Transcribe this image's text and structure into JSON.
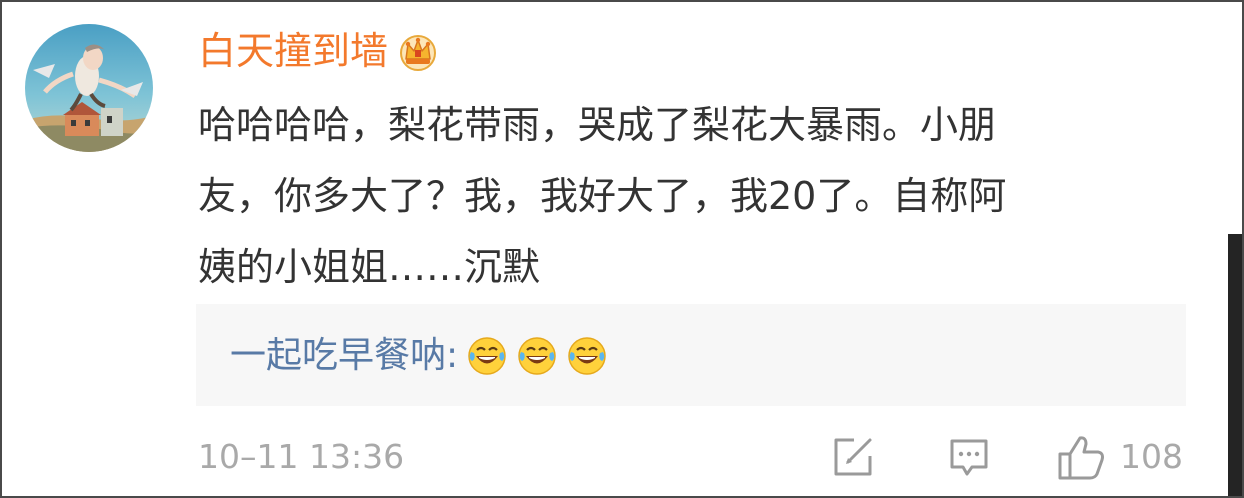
{
  "comment": {
    "username": "白天撞到墙",
    "username_color": "#f3792c",
    "badge_icon": "crown-badge-icon",
    "text_lines": [
      "哈哈哈哈，梨花带雨，哭成了梨花大暴雨。小朋",
      "友，你多大了？我，我好大了，我20了。自称阿",
      "姨的小姐姐……沉默"
    ],
    "reply": {
      "author_text": "一起吃早餐呐:",
      "author_color": "#587aa6",
      "emojis": [
        "laughing-tears-emoji",
        "laughing-tears-emoji",
        "laughing-tears-emoji"
      ]
    },
    "timestamp": "10–11 13:36",
    "actions": {
      "forward_icon": "forward-edit-icon",
      "comment_icon": "comment-bubble-icon",
      "like_icon": "thumbs-up-icon",
      "like_count": "108"
    }
  }
}
